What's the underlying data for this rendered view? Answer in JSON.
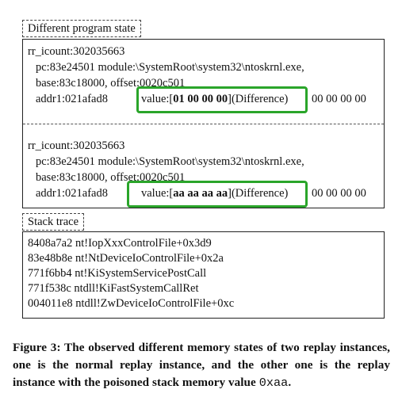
{
  "state_tag": "Different program state",
  "state1": {
    "l1": "rr_icount:302035663",
    "l2": "pc:83e24501  module:\\SystemRoot\\system32\\ntoskrnl.exe,",
    "l3": "base:83c18000, offset:0020c501",
    "addr": "addr1:021afad8",
    "val_pre": "value:[",
    "val_bytes": "01 00 00 00",
    "val_post": "](Difference)",
    "rest": "00 00 00 00"
  },
  "state2": {
    "l1": "rr_icount:302035663",
    "l2": "pc:83e24501  module:\\SystemRoot\\system32\\ntoskrnl.exe,",
    "l3": "base:83c18000, offset:0020c501",
    "addr": "addr1:021afad8",
    "val_pre": "value:[",
    "val_bytes": "aa aa aa aa",
    "val_post": "](Difference)",
    "rest": "00 00 00 00"
  },
  "stack_tag": "Stack trace",
  "stack": [
    "8408a7a2 nt!IopXxxControlFile+0x3d9",
    "83e48b8e nt!NtDeviceIoControlFile+0x2a",
    "771f6bb4 nt!KiSystemServicePostCall",
    "771f538c ntdll!KiFastSystemCallRet",
    "004011e8 ntdll!ZwDeviceIoControlFile+0xc"
  ],
  "caption": {
    "main": "Figure 3: The observed different memory states of two replay instances, one is the normal replay instance, and the other one is the replay instance with the poisoned stack memory value ",
    "code": "0xaa",
    "end": "."
  },
  "colors": {
    "highlight": "#2aa52a"
  }
}
